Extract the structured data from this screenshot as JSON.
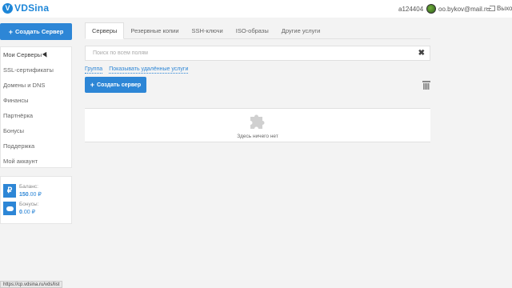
{
  "header": {
    "logo_text": "VDSina",
    "account_id": "a124404",
    "user_email": "oo.bykov@mail.ru",
    "logout_label": "Выход"
  },
  "sidebar": {
    "create_button": "Создать Сервер",
    "items": [
      {
        "label": "Мои Серверы",
        "active": true
      },
      {
        "label": "SSL-сертификаты"
      },
      {
        "label": "Домены и DNS"
      },
      {
        "label": "Финансы"
      },
      {
        "label": "Партнёрка"
      },
      {
        "label": "Бонусы"
      },
      {
        "label": "Поддержка"
      },
      {
        "label": "Мой аккаунт"
      }
    ],
    "balance": {
      "balance_label": "Баланс:",
      "balance_value": "150",
      "balance_cents": ".00 ₽",
      "bonus_label": "Бонусы:",
      "bonus_value": "0",
      "bonus_cents": ".00 ₽"
    }
  },
  "main": {
    "tabs": [
      {
        "label": "Серверы",
        "active": true
      },
      {
        "label": "Резервные копии"
      },
      {
        "label": "SSH-ключи"
      },
      {
        "label": "ISO-образы"
      },
      {
        "label": "Другие услуги"
      }
    ],
    "search_placeholder": "Поиск по всем полям",
    "links": [
      "Группа",
      "Показывать удалённые услуги"
    ],
    "create_button": "Создать сервер",
    "empty_text": "Здесь ничего нет"
  },
  "statusbar": {
    "url": "https://cp.vdsina.ru/vds/list"
  },
  "colors": {
    "accent": "#2d86d6",
    "background": "#f3f3f3"
  }
}
